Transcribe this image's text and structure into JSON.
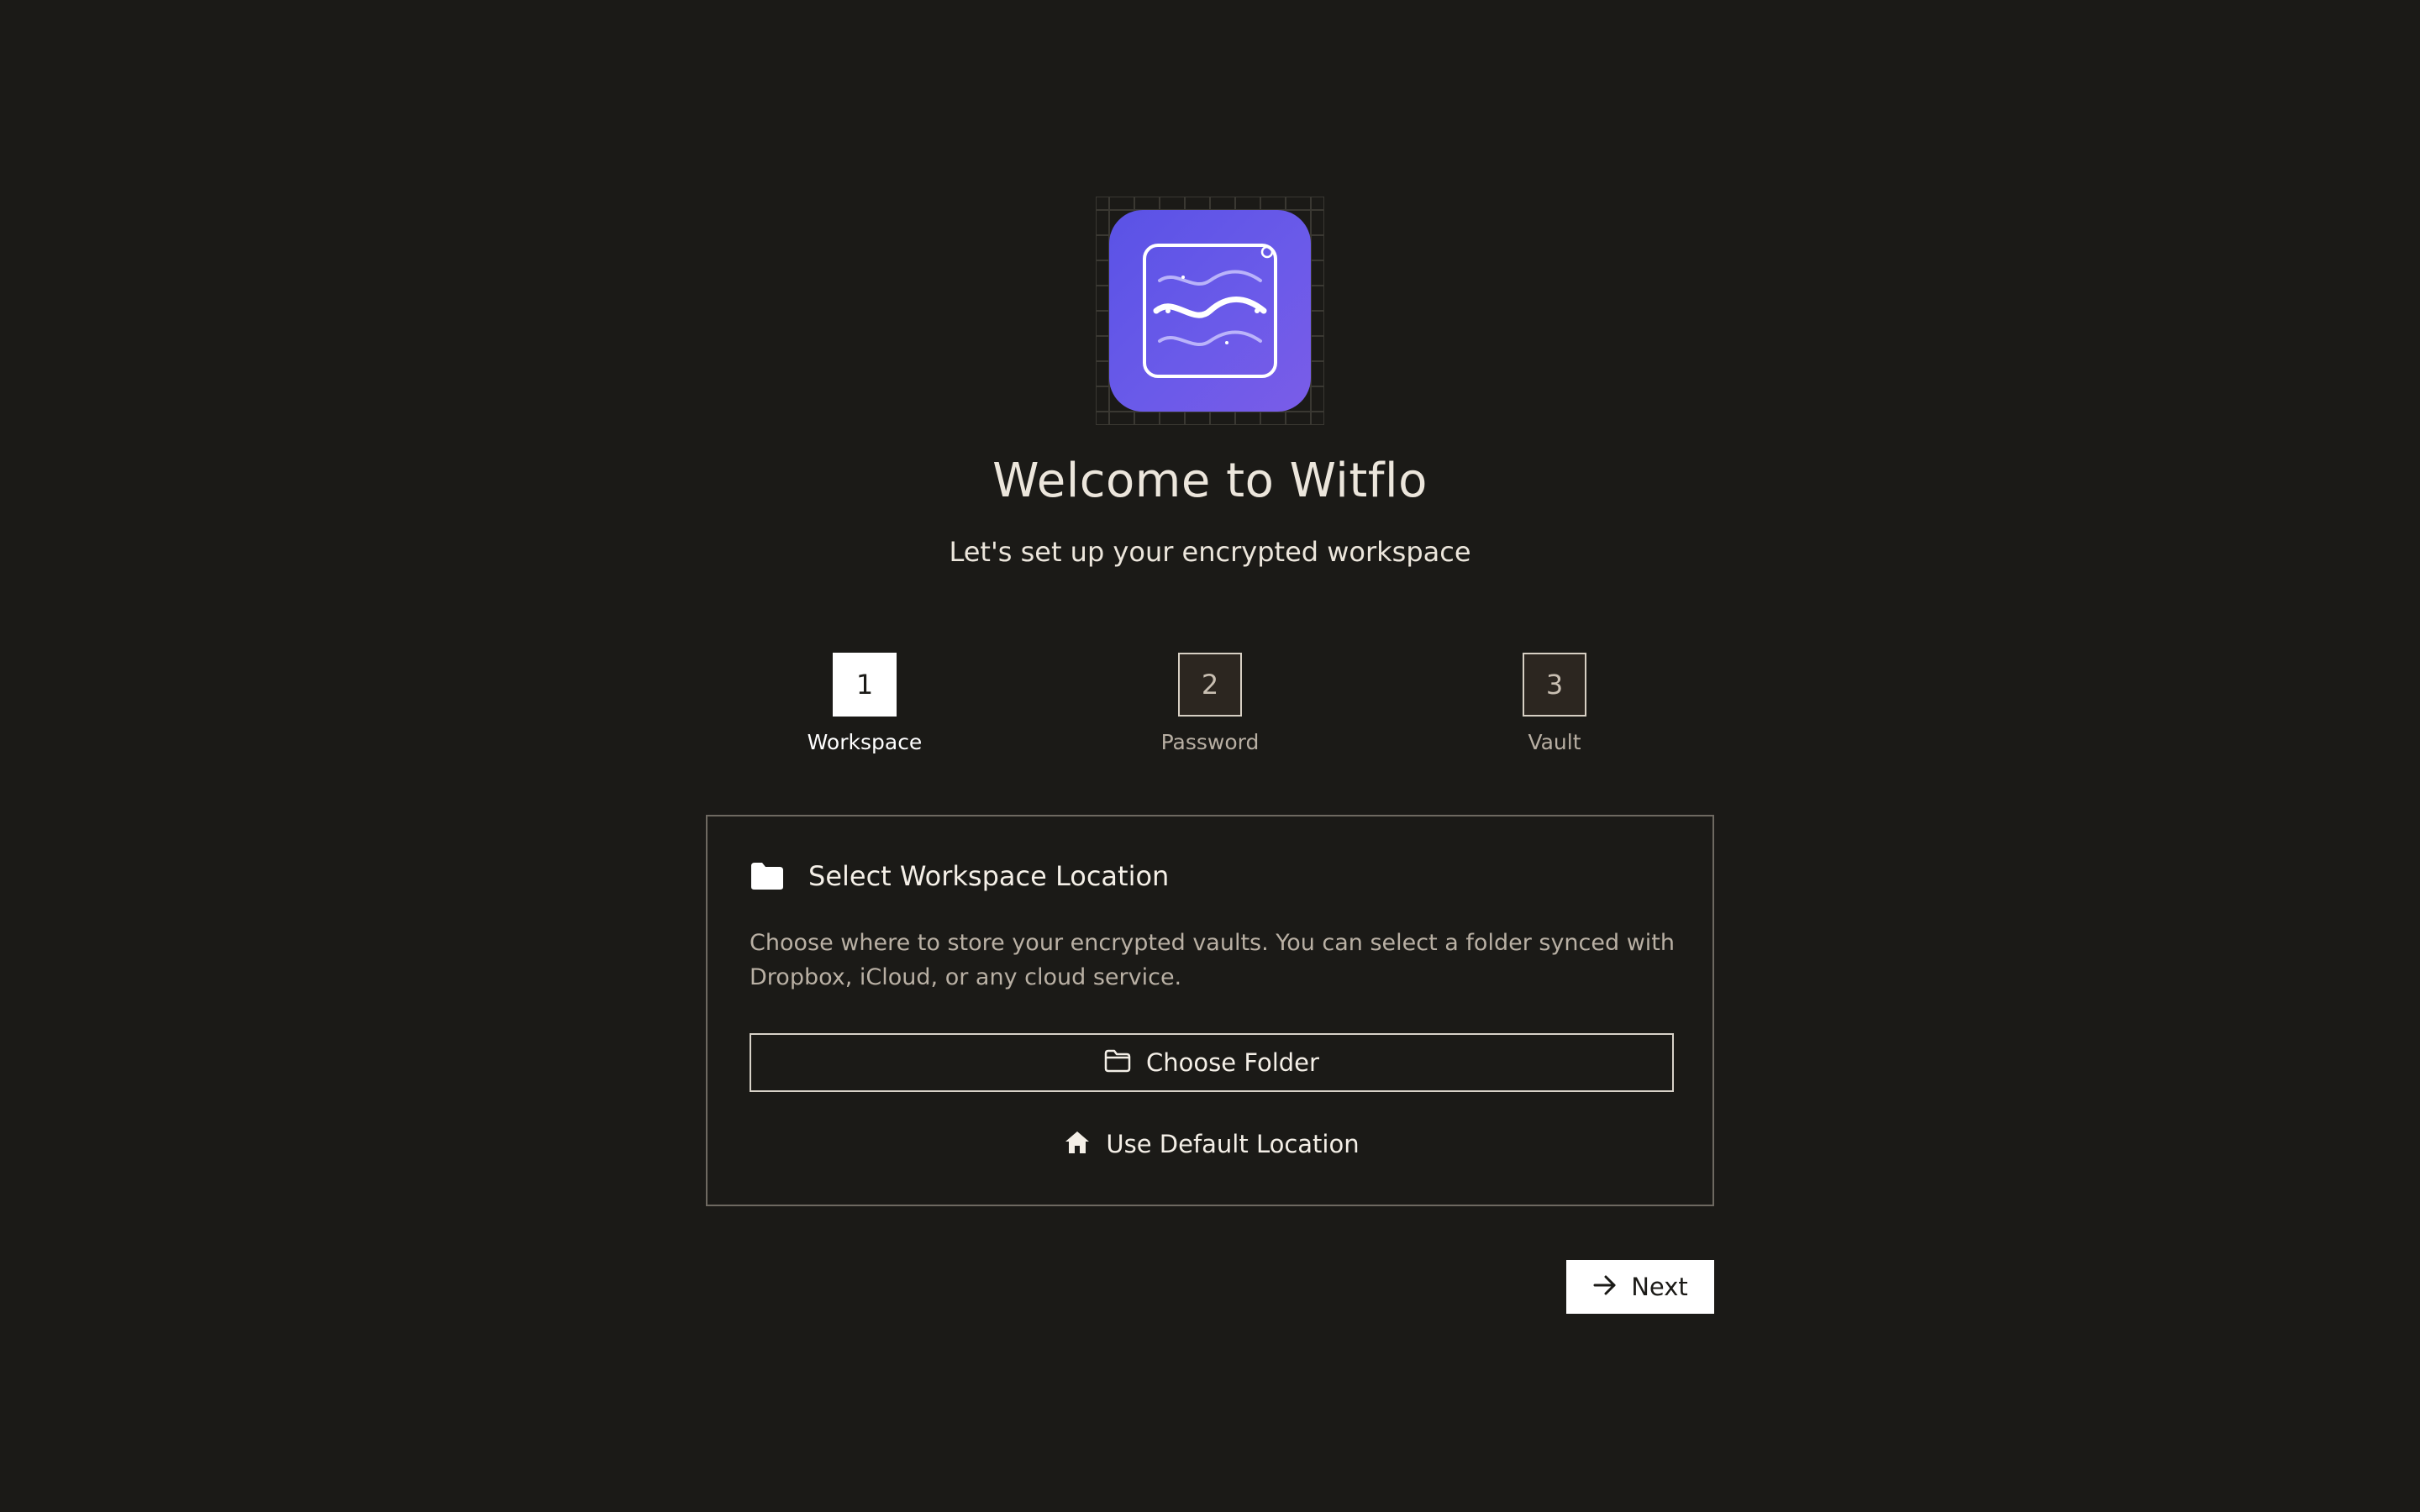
{
  "app": {
    "title": "Welcome to Witflo",
    "subtitle": "Let's set up your encrypted workspace",
    "logo_icon": "witflo-waves-logo-icon",
    "accent_color": "#5f55e8",
    "background_color": "#1b1a17"
  },
  "stepper": {
    "current_step": 1,
    "steps": [
      {
        "number": "1",
        "label": "Workspace",
        "state": "active"
      },
      {
        "number": "2",
        "label": "Password",
        "state": "inactive"
      },
      {
        "number": "3",
        "label": "Vault",
        "state": "inactive"
      }
    ]
  },
  "card": {
    "icon": "folder-icon",
    "title": "Select Workspace Location",
    "description": "Choose where to store your encrypted vaults. You can select a folder synced with Dropbox, iCloud, or any cloud service.",
    "choose_folder": {
      "label": "Choose Folder",
      "icon": "folder-outline-icon"
    },
    "use_default": {
      "label": "Use Default Location",
      "icon": "home-icon"
    }
  },
  "footer": {
    "next": {
      "label": "Next",
      "icon": "arrow-right-icon"
    }
  }
}
